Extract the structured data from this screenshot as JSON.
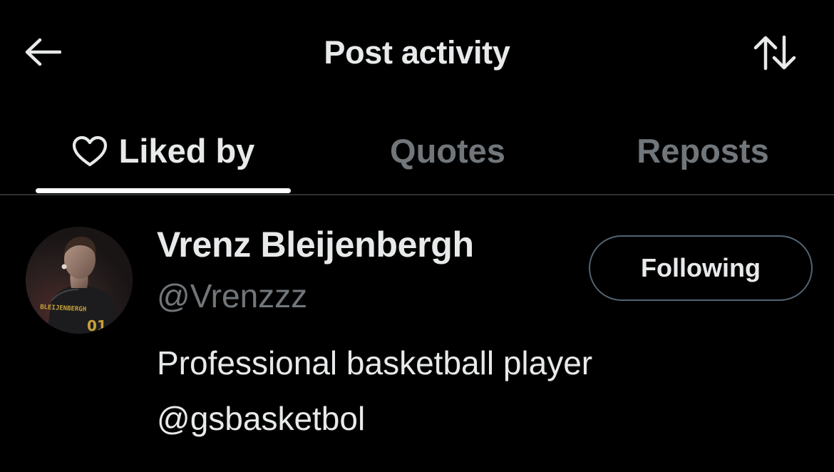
{
  "header": {
    "title": "Post activity",
    "back_icon": "arrow-left-icon",
    "sort_icon": "sort-arrows-icon"
  },
  "tabs": [
    {
      "label": "Liked by",
      "icon": "heart-outline-icon",
      "active": true
    },
    {
      "label": "Quotes",
      "active": false
    },
    {
      "label": "Reposts",
      "active": false
    }
  ],
  "users": [
    {
      "name": "Vrenz Bleijenbergh",
      "handle": "@Vrenzzz",
      "bio_line1": "Professional basketball player",
      "bio_line2": "@gsbasketbol",
      "follow_button_label": "Following",
      "avatar_jersey_text": "BLEIJENBERGH"
    }
  ],
  "colors": {
    "background": "#000000",
    "primary_text": "#e7e9ea",
    "secondary_text": "#71767b",
    "divider": "#2f3336",
    "button_border": "#536471",
    "active_indicator": "#ffffff"
  }
}
